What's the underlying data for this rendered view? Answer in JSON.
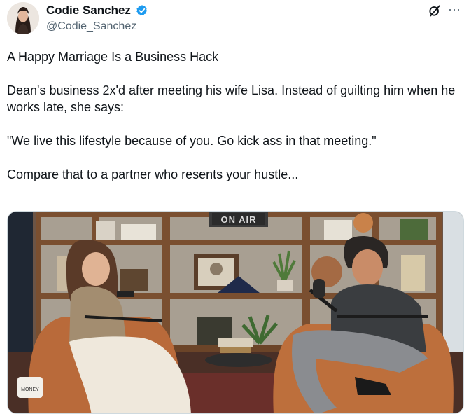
{
  "author": {
    "name": "Codie Sanchez",
    "handle": "@Codie_Sanchez",
    "verified": true
  },
  "header_icons": [
    "grok-icon",
    "more-icon"
  ],
  "more_glyph": "···",
  "tweet": {
    "paragraphs": [
      "A Happy Marriage Is a Business Hack",
      "Dean's business 2x'd after meeting his wife Lisa. Instead of guilting him when he works late, she says:",
      "\"We live this lifestyle because of you. Go kick ass in that meeting.\"",
      "Compare that to a partner who resents your hustle..."
    ]
  },
  "media": {
    "sign_text": "ON AIR",
    "mug_text": "MONEY"
  },
  "colors": {
    "text": "#0f1419",
    "secondary": "#536471",
    "verified": "#1d9bf0"
  }
}
